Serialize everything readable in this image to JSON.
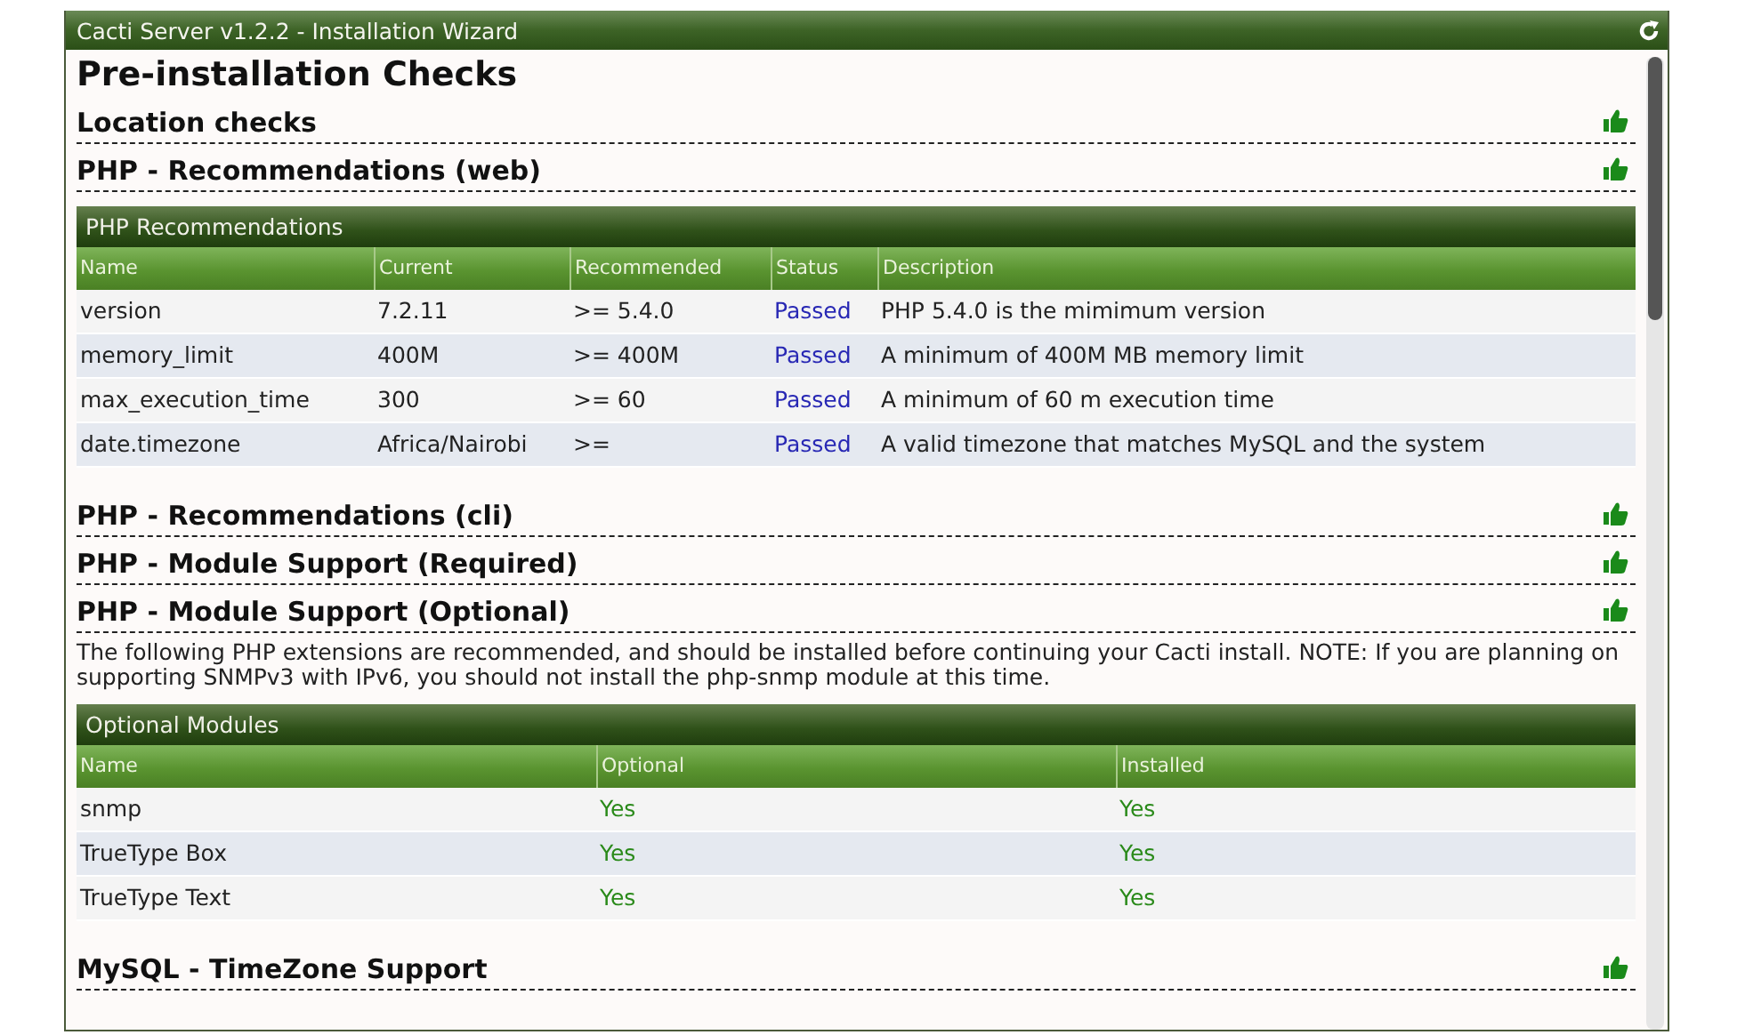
{
  "window": {
    "title": "Cacti Server v1.2.2 - Installation Wizard"
  },
  "page_title": "Pre-installation Checks",
  "content": [
    {
      "kind": "section",
      "title": "Location checks"
    },
    {
      "kind": "section",
      "title": "PHP - Recommendations (web)"
    },
    {
      "kind": "table",
      "title": "PHP Recommendations",
      "columns": [
        {
          "label": "Name",
          "kind": "text"
        },
        {
          "label": "Current",
          "kind": "text"
        },
        {
          "label": "Recommended",
          "kind": "text"
        },
        {
          "label": "Status",
          "kind": "status"
        },
        {
          "label": "Description",
          "kind": "text"
        }
      ],
      "rows": [
        [
          "version",
          "7.2.11",
          ">= 5.4.0",
          "Passed",
          "PHP 5.4.0 is the mimimum version"
        ],
        [
          "memory_limit",
          "400M",
          ">= 400M",
          "Passed",
          "A minimum of 400M MB memory limit"
        ],
        [
          "max_execution_time",
          "300",
          ">= 60",
          "Passed",
          "A minimum of 60 m execution time"
        ],
        [
          "date.timezone",
          "Africa/Nairobi",
          ">=",
          "Passed",
          "A valid timezone that matches MySQL and the system"
        ]
      ]
    },
    {
      "kind": "section",
      "title": "PHP - Recommendations (cli)"
    },
    {
      "kind": "section",
      "title": "PHP - Module Support (Required)"
    },
    {
      "kind": "section",
      "title": "PHP - Module Support (Optional)"
    },
    {
      "kind": "note",
      "text": "The following PHP extensions are recommended, and should be installed before continuing your Cacti install. NOTE: If you are planning on supporting SNMPv3 with IPv6, you should not install the php-snmp module at this time."
    },
    {
      "kind": "table",
      "title": "Optional Modules",
      "columns": [
        {
          "label": "Name",
          "kind": "text"
        },
        {
          "label": "Optional",
          "kind": "flag"
        },
        {
          "label": "Installed",
          "kind": "flag"
        }
      ],
      "rows": [
        [
          "snmp",
          "Yes",
          "Yes"
        ],
        [
          "TrueType Box",
          "Yes",
          "Yes"
        ],
        [
          "TrueType Text",
          "Yes",
          "Yes"
        ]
      ]
    },
    {
      "kind": "section",
      "title": "MySQL - TimeZone Support"
    }
  ]
}
